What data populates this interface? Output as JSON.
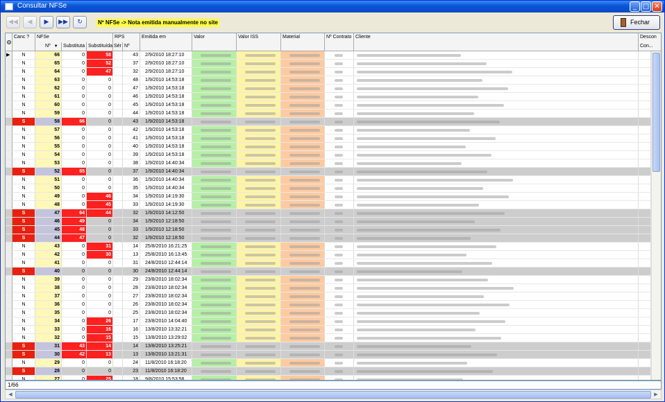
{
  "window": {
    "title": "Consultar NFSe",
    "min_label": "_",
    "max_label": "□",
    "close_label": "✕"
  },
  "toolbar": {
    "first_label": "◀◀",
    "prev_label": "◀",
    "next_label": "▶",
    "last_label": "▶▶",
    "refresh_label": "↻",
    "notice": "Nº NFSe -> Nota emitida manualmente no site",
    "close_button": "Fechar"
  },
  "columns": {
    "canc": "Canc ?",
    "nfse": "NFSe",
    "nfse_no": "Nº",
    "substituta": "Substituta",
    "substituida": "Substituída",
    "rps": "RPS",
    "ser": "Sér",
    "rps_no": "Nº",
    "emitida": "Emitida em",
    "valor": "Valor",
    "valor_iss": "Valor ISS",
    "material": "Material",
    "contrato": "Nº Contrato",
    "cliente": "Cliente",
    "desconto": "Descon",
    "desconto2": "Con..."
  },
  "rows": [
    {
      "canc": "N",
      "nfse": "66",
      "subta": "0",
      "subda": "58",
      "rps": "43",
      "emit": "2/9/2010 18:27:10"
    },
    {
      "canc": "N",
      "nfse": "65",
      "subta": "0",
      "subda": "52",
      "rps": "37",
      "emit": "2/9/2010 18:27:10"
    },
    {
      "canc": "N",
      "nfse": "64",
      "subta": "0",
      "subda": "47",
      "rps": "32",
      "emit": "2/9/2010 18:27:10"
    },
    {
      "canc": "N",
      "nfse": "63",
      "subta": "0",
      "subda": "0",
      "rps": "48",
      "emit": "1/9/2010 14:53:18"
    },
    {
      "canc": "N",
      "nfse": "62",
      "subta": "0",
      "subda": "0",
      "rps": "47",
      "emit": "1/9/2010 14:53:18"
    },
    {
      "canc": "N",
      "nfse": "61",
      "subta": "0",
      "subda": "0",
      "rps": "46",
      "emit": "1/9/2010 14:53:18"
    },
    {
      "canc": "N",
      "nfse": "60",
      "subta": "0",
      "subda": "0",
      "rps": "45",
      "emit": "1/9/2010 14:53:18"
    },
    {
      "canc": "N",
      "nfse": "59",
      "subta": "0",
      "subda": "0",
      "rps": "44",
      "emit": "1/9/2010 14:53:18"
    },
    {
      "canc": "S",
      "nfse": "58",
      "subta": "66",
      "subda": "0",
      "rps": "43",
      "emit": "1/9/2010 14:53:18"
    },
    {
      "canc": "N",
      "nfse": "57",
      "subta": "0",
      "subda": "0",
      "rps": "42",
      "emit": "1/9/2010 14:53:18"
    },
    {
      "canc": "N",
      "nfse": "56",
      "subta": "0",
      "subda": "0",
      "rps": "41",
      "emit": "1/9/2010 14:53:18"
    },
    {
      "canc": "N",
      "nfse": "55",
      "subta": "0",
      "subda": "0",
      "rps": "40",
      "emit": "1/9/2010 14:53:18"
    },
    {
      "canc": "N",
      "nfse": "54",
      "subta": "0",
      "subda": "0",
      "rps": "39",
      "emit": "1/9/2010 14:53:18"
    },
    {
      "canc": "N",
      "nfse": "53",
      "subta": "0",
      "subda": "0",
      "rps": "38",
      "emit": "1/9/2010 14:40:34"
    },
    {
      "canc": "S",
      "nfse": "52",
      "subta": "65",
      "subda": "0",
      "rps": "37",
      "emit": "1/9/2010 14:40:34"
    },
    {
      "canc": "N",
      "nfse": "51",
      "subta": "0",
      "subda": "0",
      "rps": "36",
      "emit": "1/9/2010 14:40:34"
    },
    {
      "canc": "N",
      "nfse": "50",
      "subta": "0",
      "subda": "0",
      "rps": "35",
      "emit": "1/9/2010 14:40:34"
    },
    {
      "canc": "N",
      "nfse": "49",
      "subta": "0",
      "subda": "46",
      "rps": "34",
      "emit": "1/9/2010 14:19:30"
    },
    {
      "canc": "N",
      "nfse": "48",
      "subta": "0",
      "subda": "45",
      "rps": "33",
      "emit": "1/9/2010 14:19:30"
    },
    {
      "canc": "S",
      "nfse": "47",
      "subta": "64",
      "subda": "44",
      "rps": "32",
      "emit": "1/9/2010 14:12:50"
    },
    {
      "canc": "S",
      "nfse": "46",
      "subta": "49",
      "subda": "0",
      "rps": "34",
      "emit": "1/9/2010 12:18:50"
    },
    {
      "canc": "S",
      "nfse": "45",
      "subta": "48",
      "subda": "0",
      "rps": "33",
      "emit": "1/9/2010 12:18:50"
    },
    {
      "canc": "S",
      "nfse": "44",
      "subta": "47",
      "subda": "0",
      "rps": "32",
      "emit": "1/9/2010 12:18:50"
    },
    {
      "canc": "N",
      "nfse": "43",
      "subta": "0",
      "subda": "31",
      "rps": "14",
      "emit": "25/8/2010 16:21:25"
    },
    {
      "canc": "N",
      "nfse": "42",
      "subta": "0",
      "subda": "30",
      "rps": "13",
      "emit": "25/8/2010 16:13:45"
    },
    {
      "canc": "N",
      "nfse": "41",
      "subta": "0",
      "subda": "0",
      "rps": "31",
      "emit": "24/8/2010 12:44:14"
    },
    {
      "canc": "S",
      "nfse": "40",
      "subta": "0",
      "subda": "0",
      "rps": "30",
      "emit": "24/8/2010 12:44:14"
    },
    {
      "canc": "N",
      "nfse": "39",
      "subta": "0",
      "subda": "0",
      "rps": "29",
      "emit": "23/8/2010 18:02:34"
    },
    {
      "canc": "N",
      "nfse": "38",
      "subta": "0",
      "subda": "0",
      "rps": "28",
      "emit": "23/8/2010 18:02:34"
    },
    {
      "canc": "N",
      "nfse": "37",
      "subta": "0",
      "subda": "0",
      "rps": "27",
      "emit": "23/8/2010 18:02:34"
    },
    {
      "canc": "N",
      "nfse": "36",
      "subta": "0",
      "subda": "0",
      "rps": "26",
      "emit": "23/8/2010 18:02:34"
    },
    {
      "canc": "N",
      "nfse": "35",
      "subta": "0",
      "subda": "0",
      "rps": "25",
      "emit": "23/8/2010 18:02:34"
    },
    {
      "canc": "N",
      "nfse": "34",
      "subta": "0",
      "subda": "26",
      "rps": "17",
      "emit": "23/8/2010 14:04:40"
    },
    {
      "canc": "N",
      "nfse": "33",
      "subta": "0",
      "subda": "16",
      "rps": "16",
      "emit": "13/8/2010 13:32:21"
    },
    {
      "canc": "N",
      "nfse": "32",
      "subta": "0",
      "subda": "15",
      "rps": "15",
      "emit": "13/8/2010 13:29:02"
    },
    {
      "canc": "S",
      "nfse": "31",
      "subta": "43",
      "subda": "14",
      "rps": "14",
      "emit": "13/8/2010 13:25:21"
    },
    {
      "canc": "S",
      "nfse": "30",
      "subta": "42",
      "subda": "13",
      "rps": "13",
      "emit": "13/8/2010 13:21:31"
    },
    {
      "canc": "N",
      "nfse": "29",
      "subta": "0",
      "subda": "0",
      "rps": "24",
      "emit": "11/8/2010 16:18:20"
    },
    {
      "canc": "S",
      "nfse": "28",
      "subta": "0",
      "subda": "0",
      "rps": "23",
      "emit": "11/8/2010 16:18:20"
    },
    {
      "canc": "N",
      "nfse": "27",
      "subta": "0",
      "subda": "25",
      "rps": "18",
      "emit": "9/8/2010 15:53:58"
    }
  ],
  "status": "1/66",
  "colors": {
    "cancel_red": "#e82010",
    "valor_green": "#b6f0a6",
    "iss_yellow": "#fff4a6",
    "material_orange": "#ffcaa0",
    "nfse_yellow": "#fff8b8"
  },
  "icons": {
    "settings": "gear-icon",
    "close": "door-icon",
    "sort": "sort-arrow-icon"
  }
}
